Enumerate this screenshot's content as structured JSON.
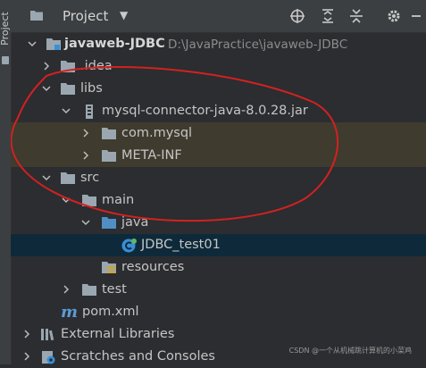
{
  "sidebar": {
    "label": "Project"
  },
  "header": {
    "title": "Project"
  },
  "tree": {
    "root": {
      "name": "javaweb-JDBC",
      "path": "D:\\JavaPractice\\javaweb-JDBC"
    },
    "idea": ".idea",
    "libs": "libs",
    "jar": "mysql-connector-java-8.0.28.jar",
    "com_mysql": "com.mysql",
    "meta_inf": "META-INF",
    "src": "src",
    "main": "main",
    "java": "java",
    "class": "JDBC_test01",
    "resources": "resources",
    "test": "test",
    "pom": "pom.xml",
    "external": "External Libraries",
    "scratches": "Scratches and Consoles"
  },
  "watermark": "CSDN @一个从机械跳计算机的小菜鸡",
  "colors": {
    "folder": "#9aa7b0",
    "annotation": "#d22121",
    "class_icon": "#3a8fd6",
    "maven": "#5c9bd8"
  },
  "icons": [
    "folder-icon",
    "jar-icon",
    "source-folder-icon",
    "resources-folder-icon",
    "class-icon",
    "maven-icon",
    "libraries-icon",
    "scratches-icon",
    "locate-icon",
    "expand-all-icon",
    "collapse-all-icon",
    "settings-icon"
  ]
}
